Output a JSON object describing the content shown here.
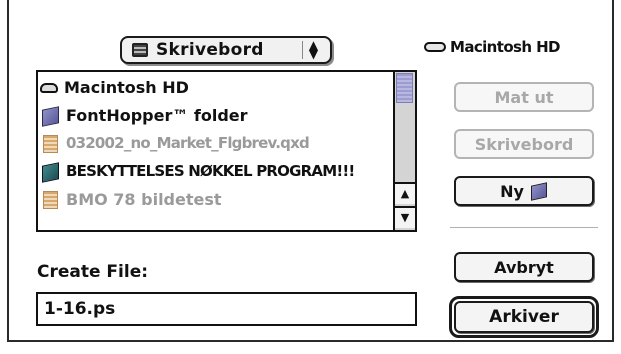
{
  "location_popup": {
    "label": "Skrivebord",
    "icon": "desktop-icon"
  },
  "volume": {
    "label": "Macintosh HD",
    "icon": "hard-disk-icon"
  },
  "file_list": {
    "items": [
      {
        "name": "Macintosh HD",
        "icon": "hard-disk-icon",
        "enabled": true
      },
      {
        "name": "FontHopper™ folder",
        "icon": "folder-icon",
        "enabled": true
      },
      {
        "name": "032002_no_Market_Flgbrev.qxd",
        "icon": "document-icon",
        "enabled": false
      },
      {
        "name": "BESKYTTELSES NØKKEL PROGRAM!!!",
        "icon": "folder-icon",
        "enabled": true
      },
      {
        "name": "BMO 78 bildetest",
        "icon": "document-icon",
        "enabled": false
      }
    ]
  },
  "buttons": {
    "eject": "Mat ut",
    "desktop": "Skrivebord",
    "new_folder": "Ny",
    "cancel": "Avbryt",
    "save": "Arkiver"
  },
  "create_file": {
    "label": "Create File:",
    "value": "1-16.ps"
  }
}
